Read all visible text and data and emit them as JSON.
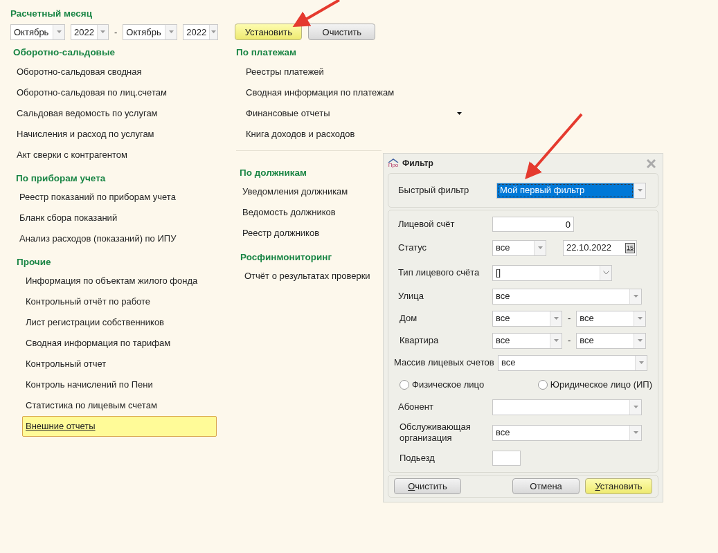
{
  "period": {
    "title": "Расчетный месяц",
    "from_month": "Октябрь",
    "from_year": "2022",
    "separator": "-",
    "to_month": "Октябрь",
    "to_year": "2022",
    "buttons": [
      {
        "label": "Установить",
        "kind": "primary"
      },
      {
        "label": "Очистить",
        "kind": "default"
      }
    ]
  },
  "left_sections": [
    {
      "title": "Оборотно-сальдовые",
      "items": [
        {
          "label": "Оборотно-сальдовая сводная",
          "kind": "link",
          "selected": false
        },
        {
          "label": "Оборотно-сальдовая по лиц.счетам",
          "kind": "link",
          "selected": false
        },
        {
          "label": "Сальдовая ведомость по услугам",
          "kind": "link",
          "selected": false
        },
        {
          "label": "Начисления и расход по услугам",
          "kind": "link",
          "selected": false
        },
        {
          "label": "Акт сверки с контрагентом",
          "kind": "link",
          "selected": false
        }
      ]
    },
    {
      "title": "По приборам учета",
      "items": [
        {
          "label": "Реестр показаний по приборам учета",
          "kind": "link",
          "selected": false
        },
        {
          "label": "Бланк сбора показаний",
          "kind": "link",
          "selected": false
        },
        {
          "label": "Анализ расходов (показаний) по ИПУ",
          "kind": "link",
          "selected": false
        }
      ]
    },
    {
      "title": "Прочие",
      "items": [
        {
          "label": "Информация по объектам жилого фонда",
          "kind": "link",
          "selected": false
        },
        {
          "label": "Контрольный отчёт по работе",
          "kind": "link",
          "selected": false
        },
        {
          "label": "Лист регистрации собственников",
          "kind": "link",
          "selected": false
        },
        {
          "label": "Сводная информация по тарифам",
          "kind": "link",
          "selected": false
        },
        {
          "label": "Контрольный отчет",
          "kind": "link",
          "selected": false
        },
        {
          "label": "Контроль начислений по Пени",
          "kind": "link",
          "selected": false
        },
        {
          "label": "Статистика по лицевым счетам",
          "kind": "link",
          "selected": false
        },
        {
          "label": "Внешние отчеты",
          "kind": "link",
          "selected": true
        }
      ]
    }
  ],
  "right_sections": [
    {
      "title": "По платежам",
      "items": [
        {
          "label": "Реестры платежей",
          "kind": "link",
          "selected": false
        },
        {
          "label": "Сводная информация по платежам",
          "kind": "link",
          "selected": false
        },
        {
          "label": "Финансовые отчеты",
          "kind": "dropdown",
          "selected": false
        },
        {
          "label": "Книга доходов и расходов",
          "kind": "link",
          "selected": false
        }
      ]
    },
    {
      "title": "По должникам",
      "items": [
        {
          "label": "Уведомления должникам",
          "kind": "link",
          "selected": false
        },
        {
          "label": "Ведомость должников",
          "kind": "link",
          "selected": false
        },
        {
          "label": "Реестр должников",
          "kind": "link",
          "selected": false
        }
      ]
    },
    {
      "title": "Росфинмониторинг",
      "items": [
        {
          "label": "Отчёт о результатах проверки",
          "kind": "link",
          "selected": false
        }
      ]
    }
  ],
  "filter_dialog": {
    "title": "Фильтр",
    "logo_text": "Про",
    "quick_filter": {
      "label": "Быстрый фильтр",
      "value": "Мой первый фильтр",
      "focused": true
    },
    "fields": [
      {
        "kind": "text",
        "label": "Лицевой счёт",
        "value": "0"
      },
      {
        "kind": "combo_date",
        "label": "Статус",
        "value": "все",
        "date": "22.10.2022",
        "calendar_label": "15"
      },
      {
        "kind": "select",
        "label": "Тип лицевого счёта",
        "value": "[]"
      },
      {
        "kind": "combo",
        "label": "Улица",
        "value": "все"
      },
      {
        "kind": "range",
        "label": "Дом",
        "from": "все",
        "separator": "-",
        "to": "все"
      },
      {
        "kind": "range",
        "label": "Квартира",
        "from": "все",
        "separator": "-",
        "to": "все"
      },
      {
        "kind": "combo",
        "label": "Массив лицевых счетов",
        "value": "все"
      },
      {
        "kind": "radios",
        "options": [
          {
            "label": "Физическое лицо",
            "selected": false
          },
          {
            "label": "Юридическое лицо (ИП)",
            "selected": false
          }
        ]
      },
      {
        "kind": "combo",
        "label": "Абонент"
      },
      {
        "kind": "combo",
        "label": "Обслуживающая организация",
        "value": "все"
      },
      {
        "kind": "short_text",
        "label": "Подьезд"
      }
    ],
    "buttons": [
      {
        "label": "Очистить",
        "kind": "default"
      },
      {
        "label": "Отмена",
        "kind": "default"
      },
      {
        "label": "Установить",
        "kind": "primary"
      }
    ]
  }
}
